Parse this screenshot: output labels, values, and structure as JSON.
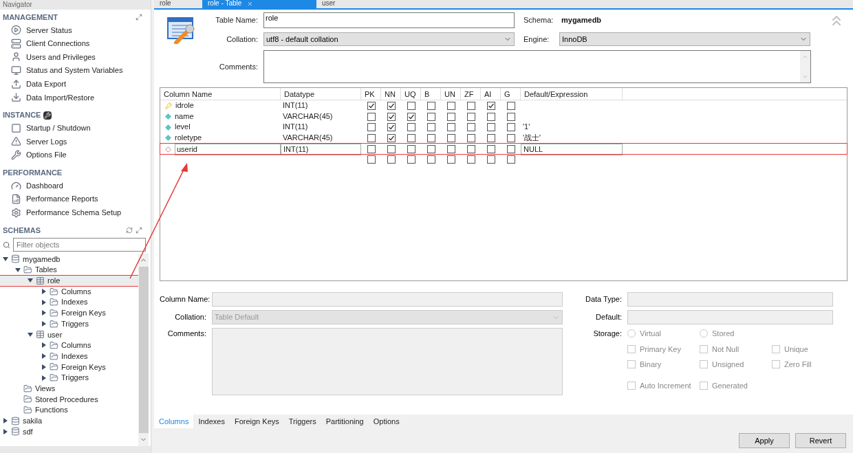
{
  "navigator": {
    "title": "Navigator",
    "sections": [
      {
        "title": "MANAGEMENT",
        "items": [
          {
            "label": "Server Status",
            "kind": "play"
          },
          {
            "label": "Client Connections",
            "kind": "server"
          },
          {
            "label": "Users and Privileges",
            "kind": "user"
          },
          {
            "label": "Status and System Variables",
            "kind": "monitor"
          },
          {
            "label": "Data Export",
            "kind": "export"
          },
          {
            "label": "Data Import/Restore",
            "kind": "import"
          }
        ]
      },
      {
        "title": "INSTANCE",
        "items": [
          {
            "label": "Startup / Shutdown",
            "kind": "power"
          },
          {
            "label": "Server Logs",
            "kind": "warning"
          },
          {
            "label": "Options File",
            "kind": "wrench"
          }
        ]
      },
      {
        "title": "PERFORMANCE",
        "items": [
          {
            "label": "Dashboard",
            "kind": "gauge"
          },
          {
            "label": "Performance Reports",
            "kind": "report"
          },
          {
            "label": "Performance Schema Setup",
            "kind": "setup"
          }
        ]
      }
    ],
    "schemas": {
      "title": "SCHEMAS",
      "filter_placeholder": "Filter objects",
      "tree": [
        {
          "label": "mygamedb",
          "kind": "database",
          "expanded": true,
          "children": [
            {
              "label": "Tables",
              "expanded": true,
              "children": [
                {
                  "label": "role",
                  "kind": "table",
                  "expanded": true,
                  "marked": true,
                  "children": [
                    {
                      "label": "Columns",
                      "expanded": false
                    },
                    {
                      "label": "Indexes",
                      "expanded": false
                    },
                    {
                      "label": "Foreign Keys",
                      "expanded": false
                    },
                    {
                      "label": "Triggers",
                      "expanded": false
                    }
                  ]
                },
                {
                  "label": "user",
                  "kind": "table",
                  "expanded": true,
                  "marked": false,
                  "children": [
                    {
                      "label": "Columns",
                      "expanded": false
                    },
                    {
                      "label": "Indexes",
                      "expanded": false
                    },
                    {
                      "label": "Foreign Keys",
                      "expanded": false
                    },
                    {
                      "label": "Triggers",
                      "expanded": false
                    }
                  ]
                }
              ]
            },
            {
              "label": "Views"
            },
            {
              "label": "Stored Procedures"
            },
            {
              "label": "Functions"
            }
          ]
        },
        {
          "label": "sakila",
          "kind": "database",
          "expanded": false
        },
        {
          "label": "sdf",
          "kind": "database",
          "expanded": false
        }
      ]
    }
  },
  "tabs": [
    {
      "label": "role",
      "selected": false
    },
    {
      "label": "role - Table",
      "selected": true,
      "closable": true
    },
    {
      "label": "user",
      "selected": false
    }
  ],
  "table_editor": {
    "table_name_label": "Table Name:",
    "table_name": "role",
    "schema_label": "Schema:",
    "schema": "mygamedb",
    "collation_label": "Collation:",
    "collation": "utf8 - default collation",
    "engine_label": "Engine:",
    "engine": "InnoDB",
    "comments_label": "Comments:"
  },
  "columns_grid": {
    "headers": [
      "Column Name",
      "Datatype",
      "PK",
      "NN",
      "UQ",
      "B",
      "UN",
      "ZF",
      "AI",
      "G",
      "Default/Expression"
    ],
    "rows": [
      {
        "kind": "primary",
        "name": "idrole",
        "datatype": "INT(11)",
        "flags": [
          true,
          true,
          false,
          false,
          false,
          false,
          true,
          false
        ]
      },
      {
        "kind": "column",
        "name": "name",
        "datatype": "VARCHAR(45)",
        "flags": [
          false,
          true,
          true,
          false,
          false,
          false,
          false,
          false
        ]
      },
      {
        "kind": "column",
        "name": "level",
        "datatype": "INT(11)",
        "flags": [
          false,
          true,
          false,
          false,
          false,
          false,
          false,
          false
        ],
        "default": "'1'"
      },
      {
        "kind": "column",
        "name": "roletype",
        "datatype": "VARCHAR(45)",
        "flags": [
          false,
          true,
          false,
          false,
          false,
          false,
          false,
          false
        ],
        "default": "'战士'"
      },
      {
        "kind": "new",
        "name": "userid",
        "datatype": "INT(11)",
        "flags": [
          false,
          false,
          false,
          false,
          false,
          false,
          false,
          false
        ],
        "default": "NULL",
        "marked": true
      },
      {
        "kind": "blank",
        "flags": [
          false,
          false,
          false,
          false,
          false,
          false,
          false,
          false
        ]
      }
    ]
  },
  "column_details": {
    "column_name_label": "Column Name:",
    "collation_label": "Collation:",
    "collation_value": "Table Default",
    "comments_label": "Comments:",
    "data_type_label": "Data Type:",
    "default_label": "Default:",
    "storage_label": "Storage:",
    "storage_options": [
      {
        "label": "Virtual",
        "selected": false
      },
      {
        "label": "Stored",
        "selected": false
      }
    ],
    "flags": [
      [
        {
          "label": "Primary Key",
          "checked": false
        },
        {
          "label": "Not Null",
          "checked": false
        },
        {
          "label": "Unique",
          "checked": false
        }
      ],
      [
        {
          "label": "Binary",
          "checked": false
        },
        {
          "label": "Unsigned",
          "checked": false
        },
        {
          "label": "Zero Fill",
          "checked": false
        }
      ],
      [
        {
          "label": "Auto Increment",
          "checked": false
        },
        {
          "label": "Generated",
          "checked": false
        }
      ]
    ]
  },
  "bottom_tabs": [
    {
      "label": "Columns",
      "selected": true
    },
    {
      "label": "Indexes",
      "selected": false
    },
    {
      "label": "Foreign Keys",
      "selected": false
    },
    {
      "label": "Triggers",
      "selected": false
    },
    {
      "label": "Partitioning",
      "selected": false
    },
    {
      "label": "Options",
      "selected": false
    }
  ],
  "buttons": [
    "Apply",
    "Revert"
  ]
}
